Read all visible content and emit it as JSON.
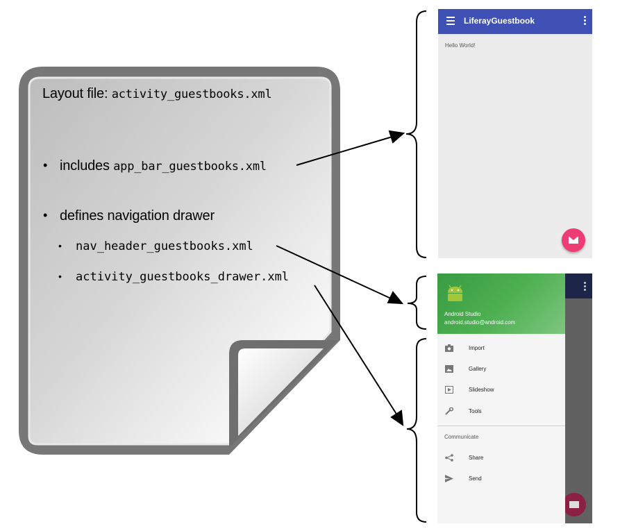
{
  "document": {
    "title_prefix": "Layout file: ",
    "title_file": "activity_guestbooks.xml",
    "bullets": {
      "includes_prefix": "includes ",
      "includes_file": "app_bar_guestbooks.xml",
      "defines": "defines navigation drawer",
      "sub1": "nav_header_guestbooks.xml",
      "sub2": "activity_guestbooks_drawer.xml"
    }
  },
  "phone_app": {
    "title": "LiferayGuestbook",
    "content_text": "Hello World!",
    "hamburger_icon": "menu-icon",
    "overflow_icon": "more-vert-icon",
    "fab_icon": "email-icon",
    "appbar_color": "#3f51b5",
    "fab_color": "#ee3d74"
  },
  "phone_drawer": {
    "header": {
      "name": "Android Studio",
      "email": "android.studio@android.com",
      "icon": "android-icon"
    },
    "menu_items": [
      {
        "label": "Import",
        "icon": "camera-icon"
      },
      {
        "label": "Gallery",
        "icon": "image-icon"
      },
      {
        "label": "Slideshow",
        "icon": "slideshow-icon"
      },
      {
        "label": "Tools",
        "icon": "wrench-icon"
      }
    ],
    "section_title": "Communicate",
    "section_items": [
      {
        "label": "Share",
        "icon": "share-icon"
      },
      {
        "label": "Send",
        "icon": "send-icon"
      }
    ],
    "header_color": "#4caf50"
  }
}
